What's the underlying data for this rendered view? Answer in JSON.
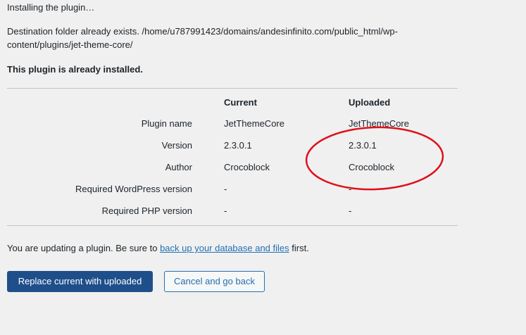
{
  "status": "Installing the plugin…",
  "destination": "Destination folder already exists. /home/u787991423/domains/andesinfinito.com/public_html/wp-content/plugins/jet-theme-core/",
  "installed_message": "This plugin is already installed.",
  "table": {
    "headers": {
      "label": "",
      "current": "Current",
      "uploaded": "Uploaded"
    },
    "rows": [
      {
        "label": "Plugin name",
        "current": "JetThemeCore",
        "uploaded": "JetThemeCore"
      },
      {
        "label": "Version",
        "current": "2.3.0.1",
        "uploaded": "2.3.0.1"
      },
      {
        "label": "Author",
        "current": "Crocoblock",
        "uploaded": "Crocoblock"
      },
      {
        "label": "Required WordPress version",
        "current": "-",
        "uploaded": "-"
      },
      {
        "label": "Required PHP version",
        "current": "-",
        "uploaded": "-"
      }
    ]
  },
  "notice": {
    "before": "You are updating a plugin. Be sure to ",
    "link": "back up your database and files",
    "after": " first."
  },
  "buttons": {
    "replace": "Replace current with uploaded",
    "cancel": "Cancel and go back"
  },
  "colors": {
    "annotation": "#e0101a",
    "link": "#2271b1",
    "primary_button": "#1e4f8a"
  }
}
